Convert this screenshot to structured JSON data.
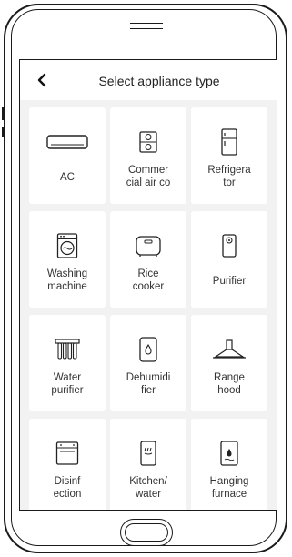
{
  "header": {
    "title": "Select appliance type",
    "back_icon": "chevron-left-icon"
  },
  "appliances": [
    {
      "label": "AC",
      "icon": "air-conditioner-icon"
    },
    {
      "label": "Commer\ncial air co",
      "icon": "commercial-air-conditioner-icon"
    },
    {
      "label": "Refrigera\ntor",
      "icon": "refrigerator-icon"
    },
    {
      "label": "Washing\nmachine",
      "icon": "washing-machine-icon"
    },
    {
      "label": "Rice\ncooker",
      "icon": "rice-cooker-icon"
    },
    {
      "label": "Purifier",
      "icon": "air-purifier-icon"
    },
    {
      "label": "Water\npurifier",
      "icon": "water-purifier-icon"
    },
    {
      "label": "Dehumidi\nfier",
      "icon": "dehumidifier-icon"
    },
    {
      "label": "Range\nhood",
      "icon": "range-hood-icon"
    },
    {
      "label": "Disinf\nection",
      "icon": "disinfection-cabinet-icon"
    },
    {
      "label": "Kitchen/\nwater",
      "icon": "kitchen-water-heater-icon"
    },
    {
      "label": "Hanging\nfurnace",
      "icon": "hanging-furnace-icon"
    }
  ],
  "colors": {
    "screen_bg": "#f2f2f2",
    "tile_bg": "#ffffff",
    "text": "#333333"
  }
}
